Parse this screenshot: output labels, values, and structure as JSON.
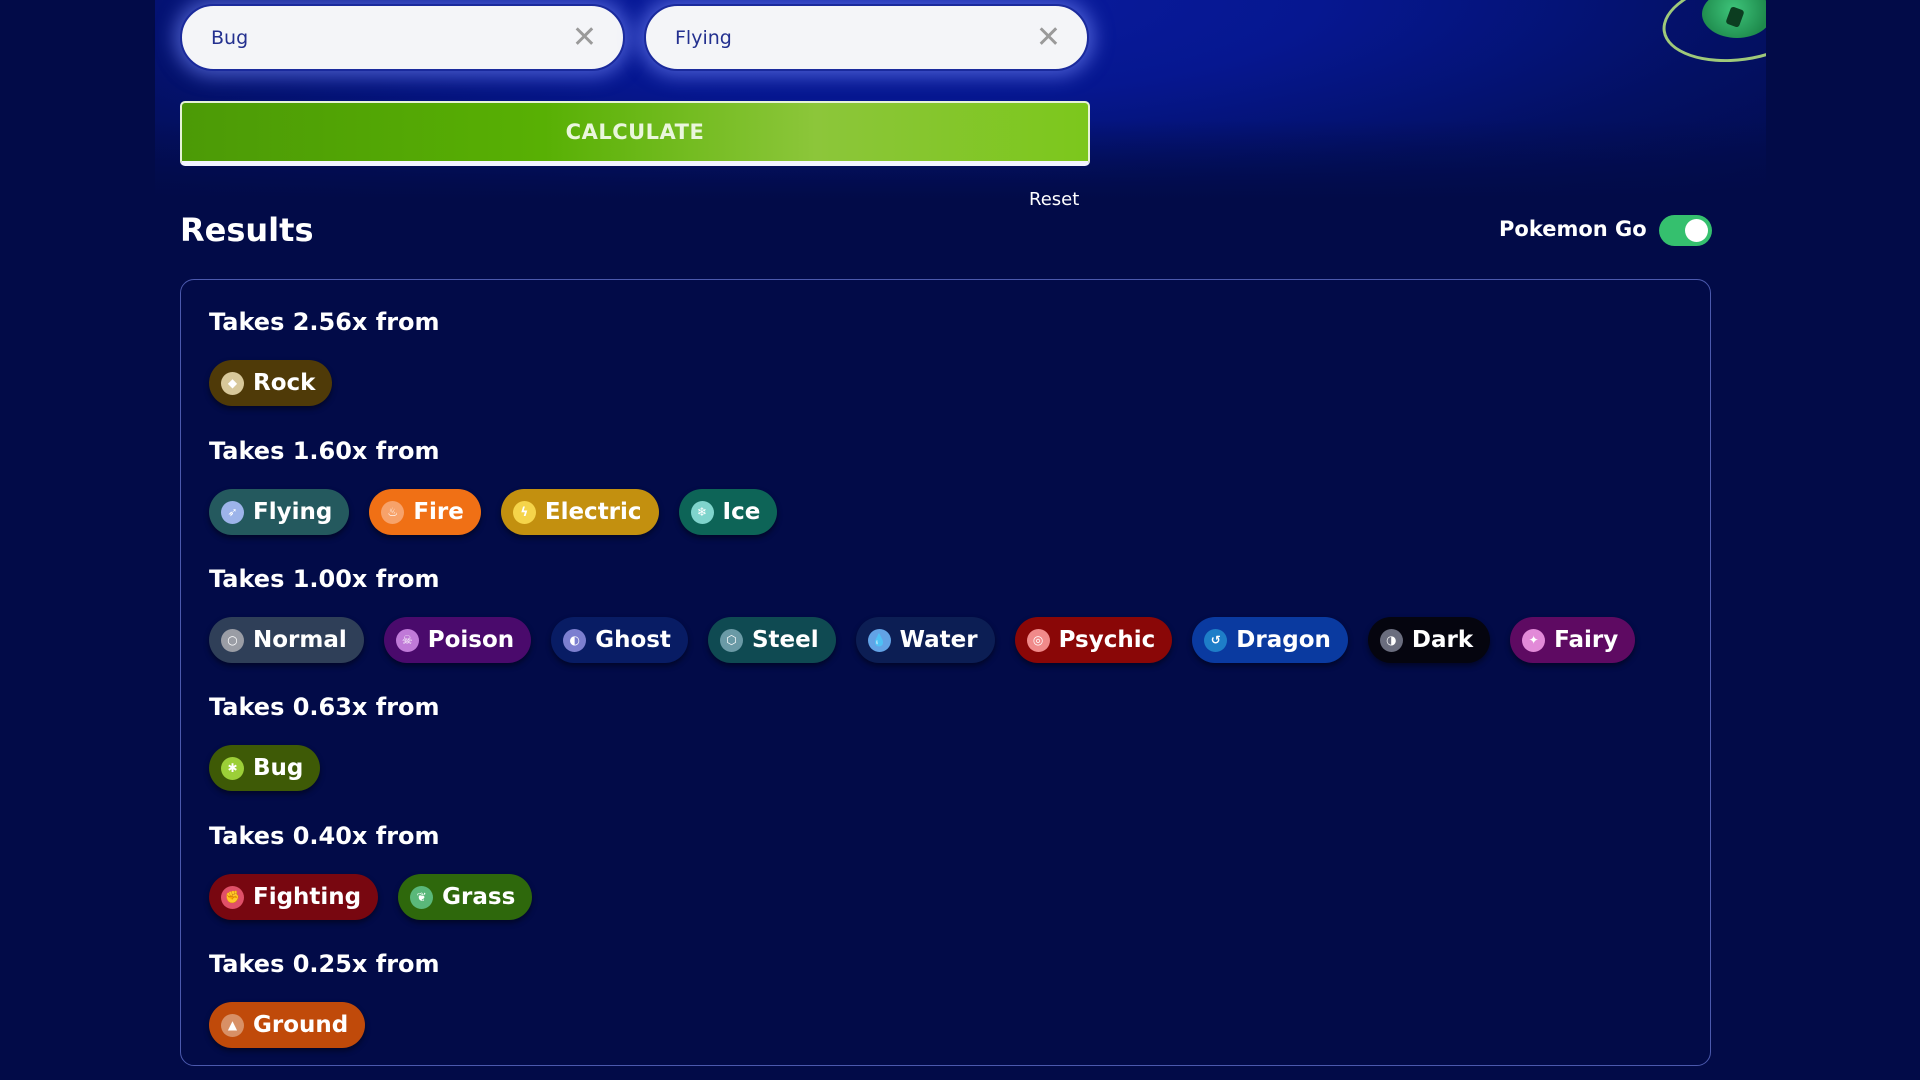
{
  "inputs": [
    {
      "value": "Bug",
      "clear_icon": "close-icon"
    },
    {
      "value": "Flying",
      "clear_icon": "close-icon"
    }
  ],
  "calculate_label": "CALCULATE",
  "reset_label": "Reset",
  "results_title": "Results",
  "pokemon_go": {
    "label": "Pokemon Go",
    "enabled": true
  },
  "groups": [
    {
      "heading": "Takes 2.56x from",
      "types": [
        {
          "name": "Rock",
          "bg": "#4f3a08",
          "icon_bg": "#d8c89a",
          "glyph": "◆"
        }
      ]
    },
    {
      "heading": "Takes 1.60x from",
      "types": [
        {
          "name": "Flying",
          "bg": "#24595e",
          "icon_bg": "#9db4ea",
          "glyph": "➶"
        },
        {
          "name": "Fire",
          "bg": "#f07015",
          "icon_bg": "#f7a26a",
          "glyph": "♨"
        },
        {
          "name": "Electric",
          "bg": "#c3900f",
          "icon_bg": "#f5d44a",
          "glyph": "ϟ"
        },
        {
          "name": "Ice",
          "bg": "#0d6457",
          "icon_bg": "#7fd4cc",
          "glyph": "❄"
        }
      ]
    },
    {
      "heading": "Takes 1.00x from",
      "types": [
        {
          "name": "Normal",
          "bg": "#2f3f58",
          "icon_bg": "#9a9da5",
          "glyph": "○"
        },
        {
          "name": "Poison",
          "bg": "#4a0a6c",
          "icon_bg": "#c07ad8",
          "glyph": "☠"
        },
        {
          "name": "Ghost",
          "bg": "#081c64",
          "icon_bg": "#7c7fd0",
          "glyph": "◐"
        },
        {
          "name": "Steel",
          "bg": "#0f4a52",
          "icon_bg": "#6a9aa6",
          "glyph": "⬡"
        },
        {
          "name": "Water",
          "bg": "#0c1e54",
          "icon_bg": "#62a3e6",
          "glyph": "💧"
        },
        {
          "name": "Psychic",
          "bg": "#8a0707",
          "icon_bg": "#f08a8a",
          "glyph": "◎"
        },
        {
          "name": "Dragon",
          "bg": "#0a3aa0",
          "icon_bg": "#1e7ec8",
          "glyph": "↺"
        },
        {
          "name": "Dark",
          "bg": "#05050f",
          "icon_bg": "#6a6d7e",
          "glyph": "◑"
        },
        {
          "name": "Fairy",
          "bg": "#5e0a62",
          "icon_bg": "#e28ad8",
          "glyph": "✦"
        }
      ]
    },
    {
      "heading": "Takes 0.63x from",
      "types": [
        {
          "name": "Bug",
          "bg": "#3e5a06",
          "icon_bg": "#9ccf38",
          "glyph": "✱"
        }
      ]
    },
    {
      "heading": "Takes 0.40x from",
      "types": [
        {
          "name": "Fighting",
          "bg": "#780710",
          "icon_bg": "#e05068",
          "glyph": "✊"
        },
        {
          "name": "Grass",
          "bg": "#2e680c",
          "icon_bg": "#5ab87a",
          "glyph": "❦"
        }
      ]
    },
    {
      "heading": "Takes 0.25x from",
      "types": [
        {
          "name": "Ground",
          "bg": "#c04a0a",
          "icon_bg": "#d89066",
          "glyph": "▲"
        }
      ]
    }
  ]
}
